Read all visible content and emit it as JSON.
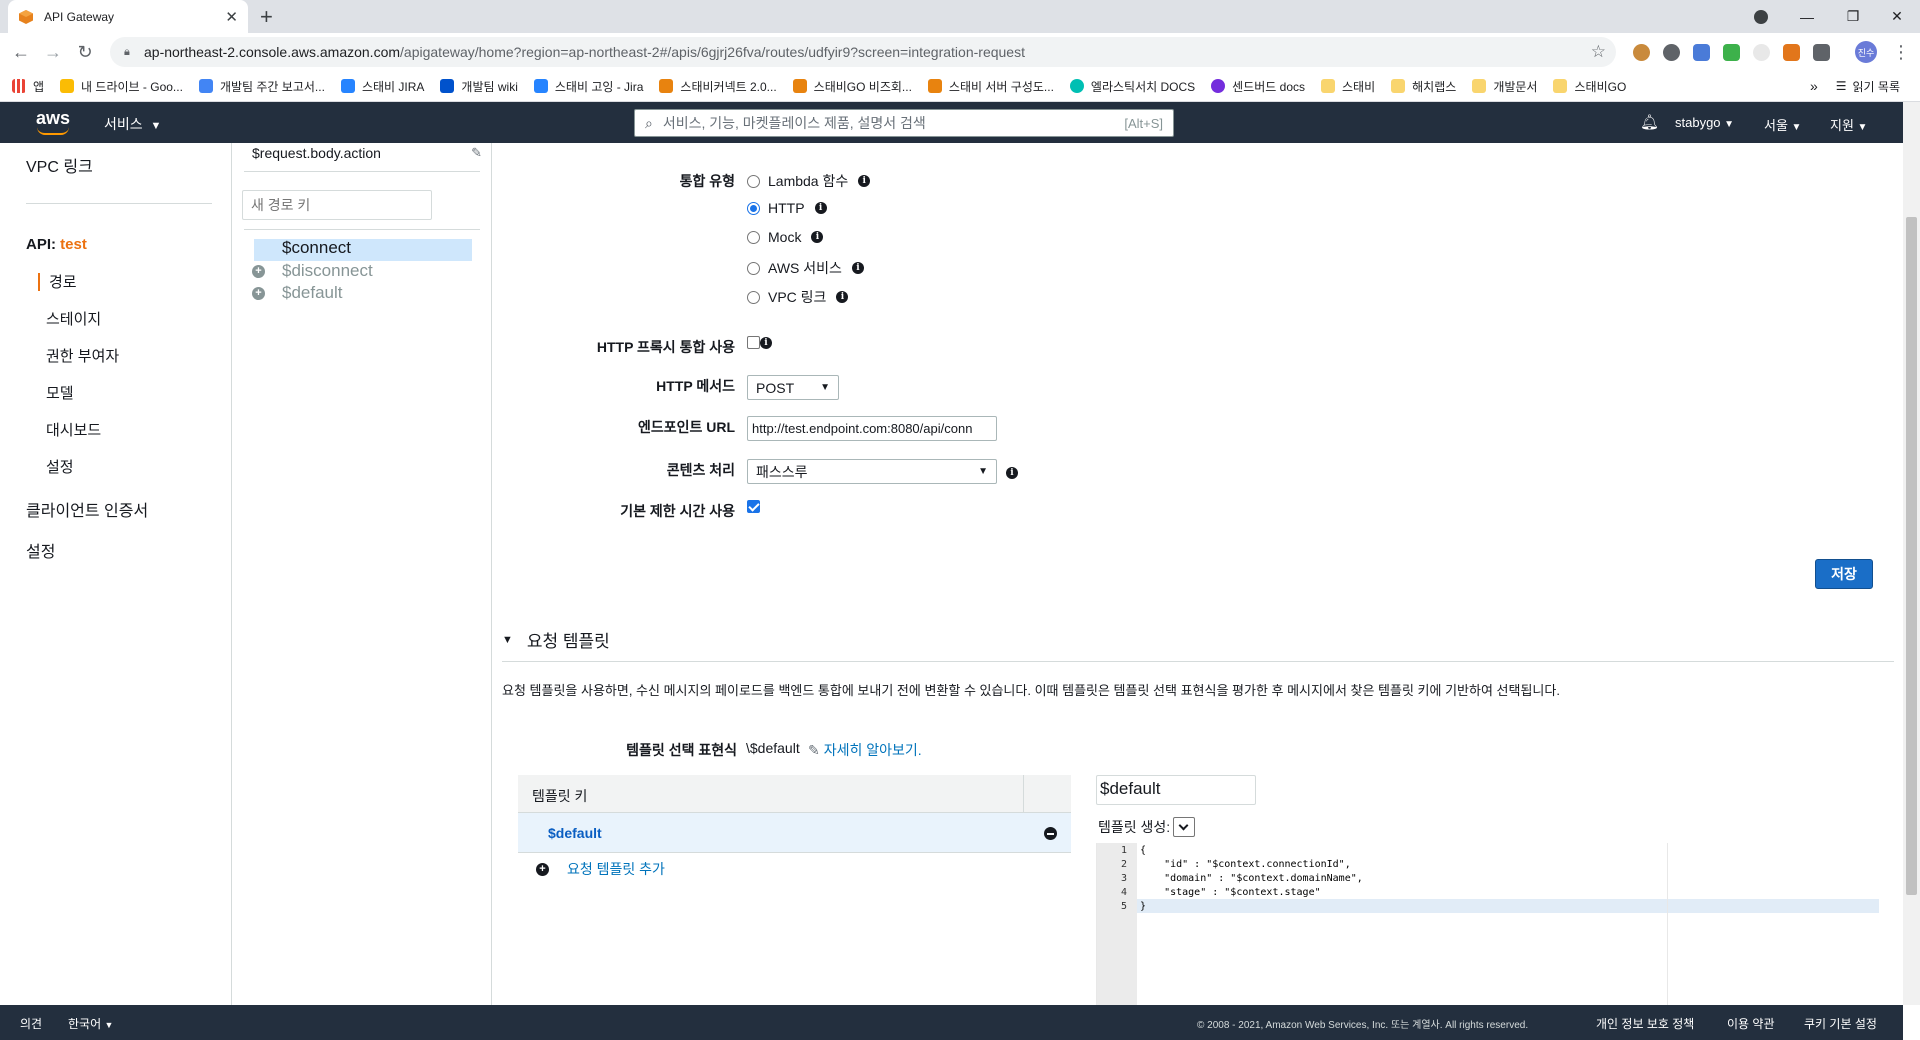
{
  "browser": {
    "tab_title": "API Gateway",
    "url_host": "ap-northeast-2.console.aws.amazon.com",
    "url_path": "/apigateway/home?region=ap-northeast-2#/apis/6gjrj26fva/routes/udfyir9?screen=integration-request",
    "profile_initials": "진수",
    "bookmarks": [
      "앱",
      "내 드라이브 - Goo...",
      "개발팀 주간 보고서...",
      "스태비 JIRA",
      "개발팀 wiki",
      "스태비 고잉 - Jira",
      "스태비커넥트 2.0...",
      "스태비GO 비즈회...",
      "스태비 서버 구성도...",
      "엘라스틱서치 DOCS",
      "센드버드 docs",
      "스태비",
      "해치랩스",
      "개발문서",
      "스태비GO"
    ],
    "bookmarks_overflow": "»",
    "reading_list": "읽기 목록"
  },
  "awsnav": {
    "logo": "aws",
    "services": "서비스",
    "search_placeholder": "서비스, 기능, 마켓플레이스 제품, 설명서 검색",
    "search_shortcut": "[Alt+S]",
    "user": "stabygo",
    "region": "서울",
    "support": "지원"
  },
  "sidebar": {
    "vpc_link": "VPC 링크",
    "api_prefix": "API:",
    "api_name": "test",
    "items": [
      "경로",
      "스테이지",
      "권한 부여자",
      "모델",
      "대시보드",
      "설정"
    ],
    "client_cert": "클라이언트 인증서",
    "settings": "설정"
  },
  "routes": {
    "selection_expression": "$request.body.action",
    "new_key_placeholder": "새 경로 키",
    "list": [
      "$connect",
      "$disconnect",
      "$default"
    ]
  },
  "form": {
    "integration_type_label": "통합 유형",
    "integration_types": [
      "Lambda 함수",
      "HTTP",
      "Mock",
      "AWS 서비스",
      "VPC 링크"
    ],
    "integration_type_selected": "HTTP",
    "http_proxy_label": "HTTP 프록시 통합 사용",
    "http_method_label": "HTTP 메서드",
    "http_method_value": "POST",
    "endpoint_label": "엔드포인트 URL",
    "endpoint_value": "http://test.endpoint.com:8080/api/conn",
    "content_handling_label": "콘텐츠 처리",
    "content_handling_value": "패스스루",
    "default_timeout_label": "기본 제한 시간 사용",
    "save_label": "저장"
  },
  "templates": {
    "section_title": "요청 템플릿",
    "description": "요청 템플릿을 사용하면, 수신 메시지의 페이로드를 백엔드 통합에 보내기 전에 변환할 수 있습니다. 이때 템플릿은 템플릿 선택 표현식을 평가한 후 메시지에서 찾은 템플릿 키에 기반하여 선택됩니다.",
    "selection_label": "템플릿 선택 표현식",
    "selection_value": "\\$default",
    "learn_more": "자세히 알아보기.",
    "key_header": "템플릿 키",
    "keys": [
      "$default"
    ],
    "add_label": "요청 템플릿 추가",
    "key_input_value": "$default",
    "generate_label": "템플릿 생성:",
    "line_numbers": [
      "1",
      "2",
      "3",
      "4",
      "5"
    ],
    "code_lines": [
      "{",
      "    \"id\" : \"$context.connectionId\",",
      "    \"domain\" : \"$context.domainName\",",
      "    \"stage\" : \"$context.stage\"",
      "}"
    ]
  },
  "footer": {
    "feedback": "의견",
    "language": "한국어",
    "copyright": "© 2008 - 2021, Amazon Web Services, Inc. 또는 계열사. All rights reserved.",
    "privacy": "개인 정보 보호 정책",
    "terms": "이용 약관",
    "cookies": "쿠키 기본 설정"
  },
  "colors": {
    "aws_nav": "#232f3e",
    "accent_orange": "#ec7211",
    "link_blue": "#0073bb",
    "save_button": "#1a6ec7"
  }
}
